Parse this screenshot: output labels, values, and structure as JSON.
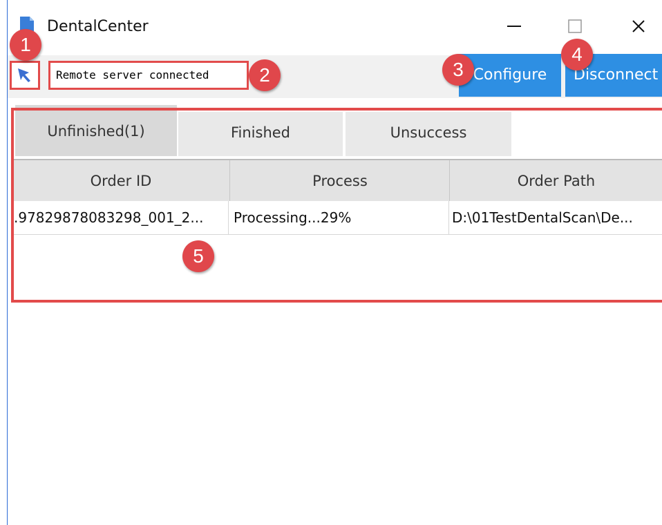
{
  "window": {
    "title": "DentalCenter",
    "controls": {
      "minimize": "—",
      "maximize": "□",
      "close": "✕"
    }
  },
  "toolbar": {
    "status_text": "Remote server connected",
    "configure_label": "Configure",
    "disconnect_label": "Disconnect"
  },
  "tabs": [
    {
      "label": "Unfinished(1)",
      "active": true
    },
    {
      "label": "Finished",
      "active": false
    },
    {
      "label": "Unsuccess",
      "active": false
    }
  ],
  "grid": {
    "columns": [
      "Order ID",
      "Process",
      "Order Path"
    ],
    "rows": [
      [
        ".97829878083298_001_2...",
        "Processing...29%",
        "D:\\01TestDentalScan\\De..."
      ]
    ]
  },
  "annotations": [
    "1",
    "2",
    "3",
    "4",
    "5"
  ],
  "colors": {
    "accent_blue": "#2e8fe3",
    "annotation_red": "#e24b4b"
  },
  "icons": {
    "app": "app-icon",
    "arrow": "pointer-arrow-icon"
  }
}
